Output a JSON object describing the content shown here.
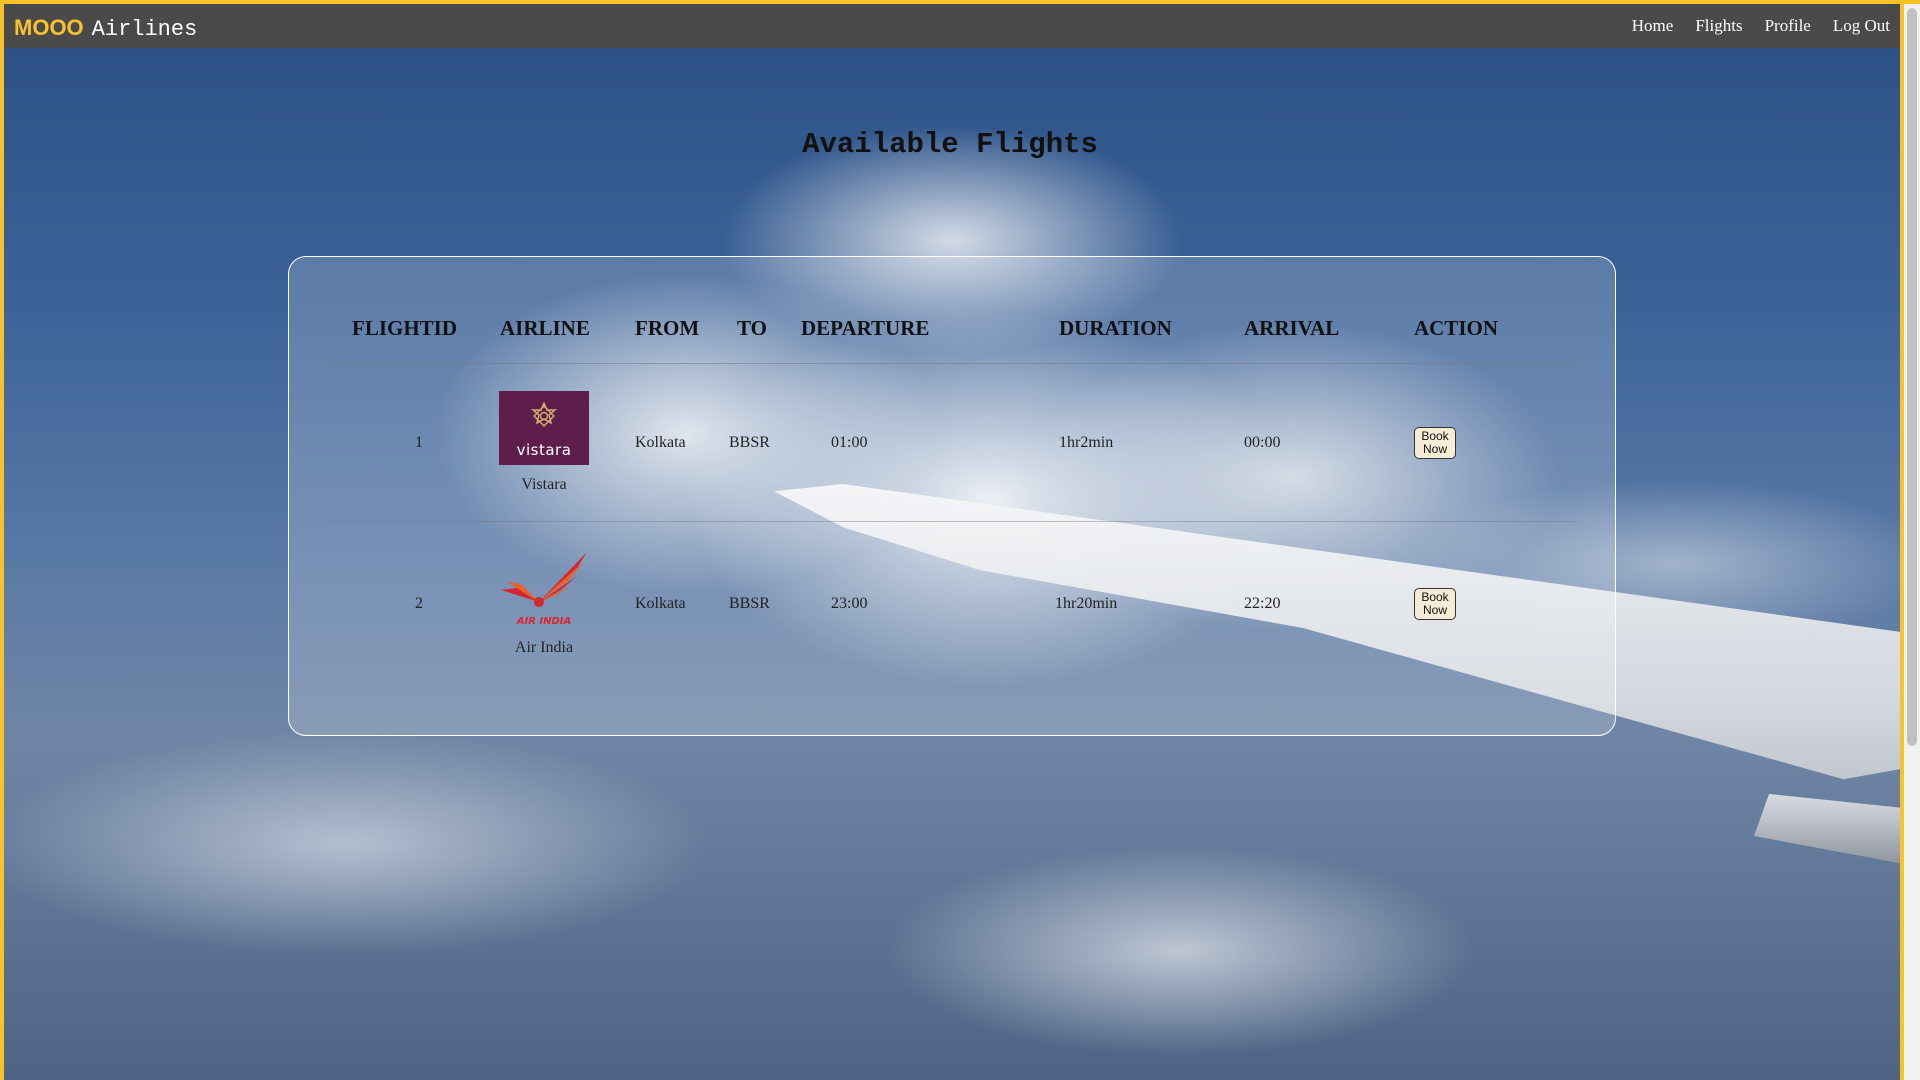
{
  "navbar": {
    "brand_strong": "MOOO",
    "brand_rest": "Airlines",
    "links": [
      "Home",
      "Flights",
      "Profile",
      "Log Out"
    ]
  },
  "page": {
    "title": "Available Flights"
  },
  "table": {
    "headers": [
      "FLIGHTID",
      "AIRLINE",
      "FROM",
      "TO",
      "DEPARTURE",
      "DURATION",
      "ARRIVAL",
      "ACTION"
    ],
    "rows": [
      {
        "flight_id": "1",
        "airline": "Vistara",
        "logo_icon": "vistara-logo-icon",
        "logo_text": "vistara",
        "from": "Kolkata",
        "to": "BBSR",
        "departure": "01:00",
        "duration": "1hr2min",
        "arrival": "00:00",
        "action": "Book Now"
      },
      {
        "flight_id": "2",
        "airline": "Air India",
        "logo_icon": "air-india-logo-icon",
        "logo_text": "AIR INDIA",
        "from": "Kolkata",
        "to": "BBSR",
        "departure": "23:00",
        "duration": "1hr20min",
        "arrival": "22:20",
        "action": "Book Now"
      }
    ]
  },
  "colors": {
    "accent": "#f9c12a",
    "navbar_bg": "#4a4a4a",
    "vistara_purple": "#5e1e4b",
    "air_india_red": "#d7262e"
  }
}
